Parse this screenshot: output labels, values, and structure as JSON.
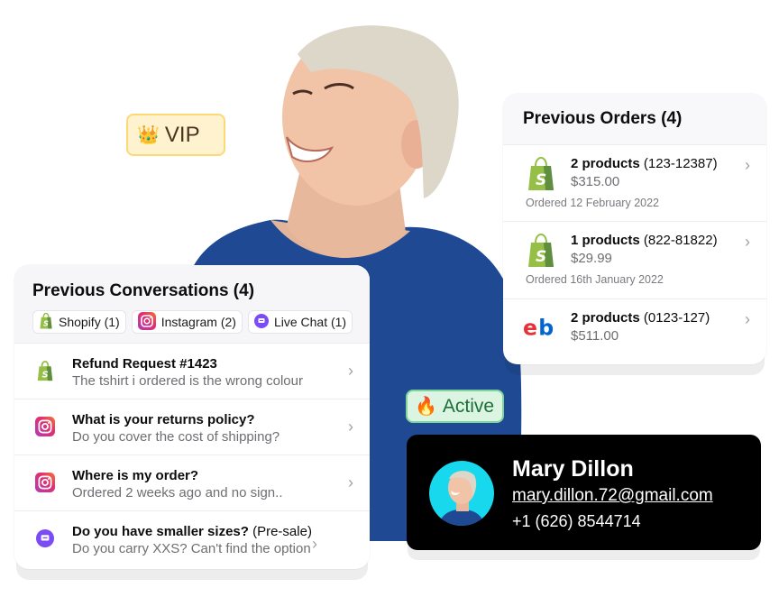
{
  "badges": {
    "vip": {
      "icon": "crown-icon",
      "emoji": "👑",
      "label": "VIP"
    },
    "active": {
      "icon": "fire-icon",
      "emoji": "🔥",
      "label": "Active"
    }
  },
  "conversations": {
    "title": "Previous Conversations (4)",
    "chips": [
      {
        "icon": "shopify-icon",
        "label": "Shopify (1)"
      },
      {
        "icon": "instagram-icon",
        "label": "Instagram (2)"
      },
      {
        "icon": "live-chat-icon",
        "label": "Live Chat (1)"
      }
    ],
    "items": [
      {
        "icon": "shopify-icon",
        "title": "Refund Request #1423",
        "tag": "",
        "subtitle": "The tshirt i ordered is the wrong colour"
      },
      {
        "icon": "instagram-icon",
        "title": "What is your returns policy?",
        "tag": "",
        "subtitle": "Do you cover the cost of shipping?"
      },
      {
        "icon": "instagram-icon",
        "title": "Where is my order?",
        "tag": "",
        "subtitle": "Ordered 2 weeks ago and no sign.."
      },
      {
        "icon": "live-chat-icon",
        "title": "Do you have smaller sizes?",
        "tag": " (Pre-sale)",
        "subtitle": "Do you carry XXS? Can't find the option"
      }
    ]
  },
  "orders": {
    "title": "Previous Orders (4)",
    "items": [
      {
        "logo": "shopify-icon",
        "products": "2 products",
        "order_id": " (123-12387)",
        "price": "$315.00",
        "date": "Ordered 12 February 2022"
      },
      {
        "logo": "shopify-icon",
        "products": "1 products",
        "order_id": " (822-81822)",
        "price": "$29.99",
        "date": "Ordered 16th January 2022"
      },
      {
        "logo": "ebay-icon",
        "products": "2 products",
        "order_id": " (0123-127)",
        "price": "$511.00",
        "date": ""
      }
    ]
  },
  "contact": {
    "name": "Mary Dillon",
    "email": "mary.dillon.72@gmail.com",
    "phone": "+1 (626) 8544714"
  },
  "colors": {
    "vip_bg": "#fff3cf",
    "vip_border": "#fcd977",
    "active_bg": "#dbf5e2",
    "active_border": "#7ed49b",
    "shopify_green": "#95bf47",
    "live_chat_purple": "#7b4cf6",
    "contact_card_bg": "#000000",
    "avatar_bg": "#17d8ec",
    "sweater_blue": "#1f4a93"
  }
}
